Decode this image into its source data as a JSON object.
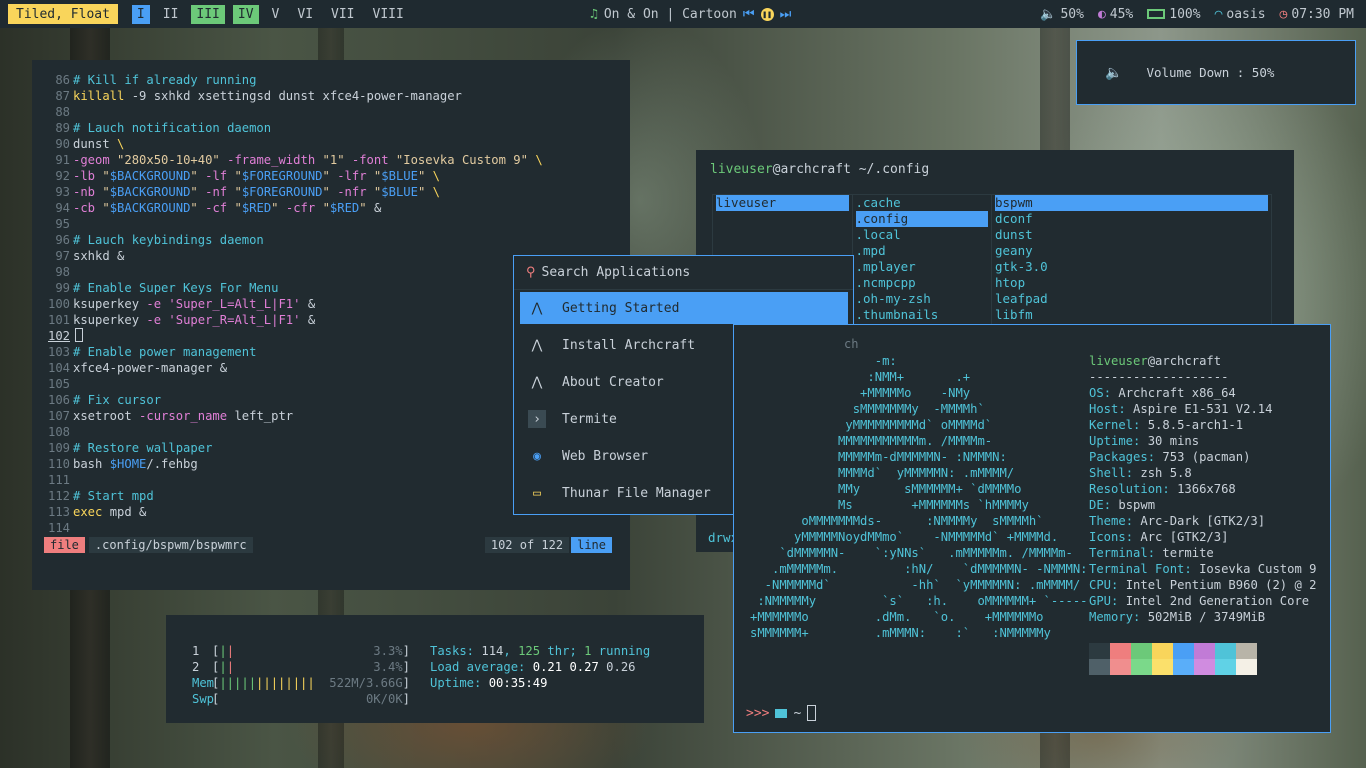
{
  "colors": {
    "accent": "#4a9ff5",
    "yellow": "#f9d55b",
    "green": "#6cc979",
    "cyan": "#4fc3d8",
    "magenta": "#e07fd6",
    "red": "#ef7e7e",
    "bg": "#212b30"
  },
  "topbar": {
    "layout": "Tiled, Float",
    "workspaces": [
      "I",
      "II",
      "III",
      "IV",
      "V",
      "VI",
      "VII",
      "VIII"
    ],
    "music": {
      "text": "On & On | Cartoon",
      "prev_icon": "prev-icon",
      "play_icon": "pause-icon",
      "next_icon": "next-icon"
    },
    "volume": "50%",
    "brightness": "45%",
    "battery": "100%",
    "wifi": "oasis",
    "time": "07:30 PM"
  },
  "notification": {
    "icon": "volume-icon",
    "text": "Volume Down : 50%"
  },
  "editor": {
    "lines": [
      {
        "n": "86",
        "t": "# Kill if already running"
      },
      {
        "n": "87",
        "t": "killall -9 sxhkd xsettingsd dunst xfce4-power-manager"
      },
      {
        "n": "88",
        "t": ""
      },
      {
        "n": "89",
        "t": "# Lauch notification daemon"
      },
      {
        "n": "90",
        "t": "dunst \\"
      },
      {
        "n": "91",
        "t": "-geom \"280x50-10+40\" -frame_width \"1\" -font \"Iosevka Custom 9\" \\"
      },
      {
        "n": "92",
        "t": "-lb \"$BACKGROUND\" -lf \"$FOREGROUND\" -lfr \"$BLUE\" \\"
      },
      {
        "n": "93",
        "t": "-nb \"$BACKGROUND\" -nf \"$FOREGROUND\" -nfr \"$BLUE\" \\"
      },
      {
        "n": "94",
        "t": "-cb \"$BACKGROUND\" -cf \"$RED\" -cfr \"$RED\" &"
      },
      {
        "n": "95",
        "t": ""
      },
      {
        "n": "96",
        "t": "# Lauch keybindings daemon"
      },
      {
        "n": "97",
        "t": "sxhkd &"
      },
      {
        "n": "98",
        "t": ""
      },
      {
        "n": "99",
        "t": "# Enable Super Keys For Menu"
      },
      {
        "n": "100",
        "t": "ksuperkey -e 'Super_L=Alt_L|F1' &"
      },
      {
        "n": "101",
        "t": "ksuperkey -e 'Super_R=Alt_L|F1' &"
      },
      {
        "n": "102",
        "t": ""
      },
      {
        "n": "103",
        "t": "# Enable power management"
      },
      {
        "n": "104",
        "t": "xfce4-power-manager &"
      },
      {
        "n": "105",
        "t": ""
      },
      {
        "n": "106",
        "t": "# Fix cursor"
      },
      {
        "n": "107",
        "t": "xsetroot -cursor_name left_ptr"
      },
      {
        "n": "108",
        "t": ""
      },
      {
        "n": "109",
        "t": "# Restore wallpaper"
      },
      {
        "n": "110",
        "t": "bash $HOME/.fehbg"
      },
      {
        "n": "111",
        "t": ""
      },
      {
        "n": "112",
        "t": "# Start mpd"
      },
      {
        "n": "113",
        "t": "exec mpd &"
      },
      {
        "n": "114",
        "t": ""
      }
    ],
    "status": {
      "mode_left": "file",
      "path": ".config/bspwm/bspwmrc",
      "position": "102 of 122",
      "mode_right": "line"
    }
  },
  "filemanager": {
    "title_user": "liveuser",
    "title_host": "@archcraft",
    "title_path": " ~/.config",
    "col1": [
      "liveuser"
    ],
    "col2": [
      ".cache",
      ".config",
      ".local",
      ".mpd",
      ".mplayer",
      ".ncmpcpp",
      ".oh-my-zsh",
      ".thumbnails"
    ],
    "col3": [
      "bspwm",
      "dconf",
      "dunst",
      "geany",
      "gtk-3.0",
      "htop",
      "leafpad",
      "libfm"
    ],
    "footer": "drwx"
  },
  "launcher": {
    "placeholder": "Search Applications",
    "items": [
      {
        "label": "Getting Started",
        "icon": "archcraft-icon"
      },
      {
        "label": "Install Archcraft",
        "icon": "archcraft-icon"
      },
      {
        "label": "About Creator",
        "icon": "archcraft-icon"
      },
      {
        "label": "Termite",
        "icon": "terminal-icon"
      },
      {
        "label": "Web Browser",
        "icon": "browser-icon"
      },
      {
        "label": "Thunar File Manager",
        "icon": "folder-icon"
      }
    ]
  },
  "neofetch": {
    "hidden_title": "ch",
    "ascii": [
      "                 -m:",
      "                :NMM+       .+",
      "               +MMMMMo    -NMy",
      "              sMMMMMMMy  -MMMMh`",
      "             yMMMMMMMMMd` oMMMMd`",
      "            MMMMMMMMMMMm. /MMMMm-",
      "            MMMMMm-dMMMMMN- :NMMMN:",
      "            MMMMd`  yMMMMMN: .mMMMM/",
      "            MMy      sMMMMMM+ `dMMMMo",
      "            Ms        +MMMMMMs `hMMMMy",
      "       oMMMMMMMds-      :NMMMMy  sMMMMh`",
      "      yMMMMMNoydMMmo`    -NMMMMMd` +MMMMd.",
      "    `dMMMMMN-    `:yNNs`   .mMMMMMm. /MMMMm-",
      "   .mMMMMMm.         :hN/    `dMMMMMN- -NMMMN:",
      "  -NMMMMMd`           -hh`  `yMMMMMN: .mMMMM/",
      " :NMMMMMy         `s`   :h.    oMMMMMM+ `-----",
      "+MMMMMMo         .dMm.   `o.    +MMMMMMo",
      "sMMMMMM+         .mMMMN:    :`   :NMMMMMy"
    ],
    "user": "liveuser",
    "host": "@archcraft",
    "sep": "-------------------",
    "info": [
      {
        "k": "OS",
        "v": "Archcraft x86_64"
      },
      {
        "k": "Host",
        "v": "Aspire E1-531 V2.14"
      },
      {
        "k": "Kernel",
        "v": "5.8.5-arch1-1"
      },
      {
        "k": "Uptime",
        "v": "30 mins"
      },
      {
        "k": "Packages",
        "v": "753 (pacman)"
      },
      {
        "k": "Shell",
        "v": "zsh 5.8"
      },
      {
        "k": "Resolution",
        "v": "1366x768"
      },
      {
        "k": "DE",
        "v": "bspwm"
      },
      {
        "k": "Theme",
        "v": "Arc-Dark [GTK2/3]"
      },
      {
        "k": "Icons",
        "v": "Arc [GTK2/3]"
      },
      {
        "k": "Terminal",
        "v": "termite"
      },
      {
        "k": "Terminal Font",
        "v": "Iosevka Custom 9"
      },
      {
        "k": "CPU",
        "v": "Intel Pentium B960 (2) @ 2"
      },
      {
        "k": "GPU",
        "v": "Intel 2nd Generation Core"
      },
      {
        "k": "Memory",
        "v": "502MiB / 3749MiB"
      }
    ],
    "palette": [
      "#2c3a40",
      "#ef7e7e",
      "#6cc979",
      "#f9d55b",
      "#4a9ff5",
      "#c17bd6",
      "#4fc3d8",
      "#b8b4a8",
      "#4f6068",
      "#f08e8e",
      "#7bd98a",
      "#fbe06b",
      "#5aaef9",
      "#d08ce0",
      "#60d2e6",
      "#f4f0e6"
    ],
    "prompt_arrows": ">>>",
    "prompt_folder": "folder-icon",
    "prompt_path": "~"
  },
  "htop": {
    "cpu1": {
      "label": "1",
      "pct": "3.3%"
    },
    "cpu2": {
      "label": "2",
      "pct": "3.4%"
    },
    "mem": {
      "label": "Mem",
      "value": "522M/3.66G"
    },
    "swp": {
      "label": "Swp",
      "value": "0K/0K"
    },
    "tasks_label": "Tasks: ",
    "tasks": "114",
    "thr_sep": ", ",
    "thr": "125",
    "thr_label": " thr; ",
    "running": "1",
    "running_label": " running",
    "load_label": "Load average: ",
    "load1": "0.21",
    "load5": "0.27",
    "load15": "0.26",
    "uptime_label": "Uptime: ",
    "uptime": "00:35:49"
  }
}
